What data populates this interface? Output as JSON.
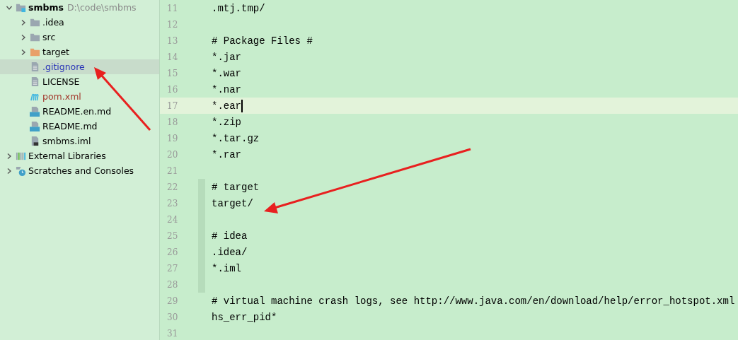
{
  "project_tree": [
    {
      "name": "smbms",
      "path": "D:\\code\\smbms",
      "kind": "module",
      "expanded": true,
      "selected": false,
      "color": "#000000",
      "children": [
        {
          "name": ".idea",
          "kind": "folder",
          "expanded": false,
          "selected": false,
          "color": "#000000"
        },
        {
          "name": "src",
          "kind": "folder",
          "expanded": false,
          "selected": false,
          "color": "#000000"
        },
        {
          "name": "target",
          "kind": "excluded-folder",
          "expanded": false,
          "selected": false,
          "color": "#000000"
        },
        {
          "name": ".gitignore",
          "kind": "text-file",
          "selected": true,
          "color": "#2b35b8"
        },
        {
          "name": "LICENSE",
          "kind": "text-file",
          "selected": false,
          "color": "#000000"
        },
        {
          "name": "pom.xml",
          "kind": "maven",
          "selected": false,
          "color": "#a3382c"
        },
        {
          "name": "README.en.md",
          "kind": "markdown",
          "selected": false,
          "color": "#000000"
        },
        {
          "name": "README.md",
          "kind": "markdown",
          "selected": false,
          "color": "#000000"
        },
        {
          "name": "smbms.iml",
          "kind": "iml",
          "selected": false,
          "color": "#000000"
        }
      ]
    },
    {
      "name": "External Libraries",
      "kind": "libraries",
      "expanded": false,
      "selected": false,
      "color": "#000000"
    },
    {
      "name": "Scratches and Consoles",
      "kind": "scratches",
      "expanded": false,
      "selected": false,
      "color": "#000000"
    }
  ],
  "editor": {
    "lines": [
      {
        "number": "11",
        "text": ".mtj.tmp/",
        "current": false,
        "modified": false
      },
      {
        "number": "12",
        "current": false,
        "modified": false
      },
      {
        "number": "13",
        "text": "# Package Files #",
        "current": false,
        "modified": false
      },
      {
        "number": "14",
        "text": "*.jar",
        "current": false,
        "modified": false
      },
      {
        "number": "15",
        "text": "*.war",
        "current": false,
        "modified": false
      },
      {
        "number": "16",
        "text": "*.nar",
        "current": false,
        "modified": false
      },
      {
        "number": "17",
        "text": "*.ear",
        "current": true,
        "modified": false
      },
      {
        "number": "18",
        "text": "*.zip",
        "current": false,
        "modified": false
      },
      {
        "number": "19",
        "text": "*.tar.gz",
        "current": false,
        "modified": false
      },
      {
        "number": "20",
        "text": "*.rar",
        "current": false,
        "modified": false
      },
      {
        "number": "21",
        "current": false,
        "modified": false
      },
      {
        "number": "22",
        "text": "# target",
        "current": false,
        "modified": true
      },
      {
        "number": "23",
        "text": "target/",
        "current": false,
        "modified": true
      },
      {
        "number": "24",
        "current": false,
        "modified": true
      },
      {
        "number": "25",
        "text": "# idea",
        "current": false,
        "modified": true
      },
      {
        "number": "26",
        "text": ".idea/",
        "current": false,
        "modified": true
      },
      {
        "number": "27",
        "text": "*.iml",
        "current": false,
        "modified": true
      },
      {
        "number": "28",
        "current": false,
        "modified": true
      },
      {
        "number": "29",
        "text": "# virtual machine crash logs, see http://www.java.com/en/download/help/error_hotspot.xml",
        "current": false,
        "modified": false
      },
      {
        "number": "30",
        "text": "hs_err_pid*",
        "current": false,
        "modified": false
      },
      {
        "number": "31",
        "current": false,
        "modified": false
      }
    ]
  }
}
